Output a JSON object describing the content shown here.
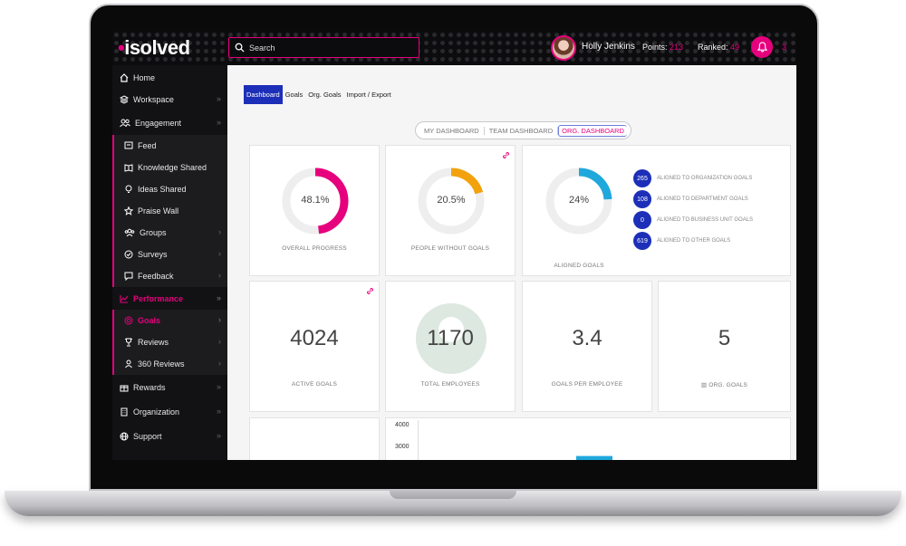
{
  "header": {
    "logo": "isolved",
    "search_placeholder": "Search",
    "user_name": "Holly Jenkins",
    "points_label": "Points:",
    "points_value": "213",
    "ranked_label": "Ranked:",
    "ranked_value": "49",
    "notification_count": "3"
  },
  "sidebar": {
    "items": [
      {
        "label": "Home",
        "icon": "home-icon"
      },
      {
        "label": "Workspace",
        "icon": "layers-icon"
      },
      {
        "label": "Engagement",
        "icon": "users-icon"
      },
      {
        "label": "Feed",
        "icon": "feed-icon"
      },
      {
        "label": "Knowledge Shared",
        "icon": "book-icon"
      },
      {
        "label": "Ideas Shared",
        "icon": "lightbulb-icon"
      },
      {
        "label": "Praise Wall",
        "icon": "star-icon"
      },
      {
        "label": "Groups",
        "icon": "group-icon"
      },
      {
        "label": "Surveys",
        "icon": "survey-icon"
      },
      {
        "label": "Feedback",
        "icon": "feedback-icon"
      },
      {
        "label": "Performance",
        "icon": "chart-icon"
      },
      {
        "label": "Goals",
        "icon": "target-icon"
      },
      {
        "label": "Reviews",
        "icon": "trophy-icon"
      },
      {
        "label": "360 Reviews",
        "icon": "review-icon"
      },
      {
        "label": "Rewards",
        "icon": "gift-icon"
      },
      {
        "label": "Organization",
        "icon": "building-icon"
      },
      {
        "label": "Support",
        "icon": "globe-icon"
      }
    ]
  },
  "tabs": [
    "Dashboard",
    "Goals",
    "Org. Goals",
    "Import / Export"
  ],
  "segment": [
    "MY DASHBOARD",
    "TEAM DASHBOARD",
    "ORG. DASHBOARD"
  ],
  "cards": {
    "overall_progress": {
      "value": "48.1%",
      "percent": 48.1,
      "caption": "OVERALL PROGRESS"
    },
    "people_without_goals": {
      "value": "20.5%",
      "percent": 20.5,
      "caption": "PEOPLE WITHOUT GOALS"
    },
    "aligned_goals": {
      "value": "24%",
      "percent": 24,
      "caption": "ALIGNED GOALS"
    },
    "aligned_legend": [
      {
        "count": "265",
        "label": "ALIGNED TO ORGANIZATION GOALS"
      },
      {
        "count": "108",
        "label": "ALIGNED TO DEPARTMENT GOALS"
      },
      {
        "count": "0",
        "label": "ALIGNED TO BUSINESS UNIT GOALS"
      },
      {
        "count": "619",
        "label": "ALIGNED TO OTHER GOALS"
      }
    ],
    "active_goals": {
      "value": "4024",
      "caption": "ACTIVE GOALS"
    },
    "total_employees": {
      "value": "1170",
      "caption": "TOTAL EMPLOYEES"
    },
    "goals_per_employee": {
      "value": "3.4",
      "caption": "GOALS PER EMPLOYEE"
    },
    "org_goals": {
      "value": "5",
      "caption": "ORG. GOALS"
    }
  },
  "colors": {
    "accent": "#e6007e",
    "primary": "#1d2fb8",
    "orange": "#f2a20c",
    "cyan": "#1fa8dc"
  },
  "chart_data": {
    "type": "bar",
    "yticks": [
      "4000",
      "3000"
    ],
    "values": [
      2600
    ]
  }
}
